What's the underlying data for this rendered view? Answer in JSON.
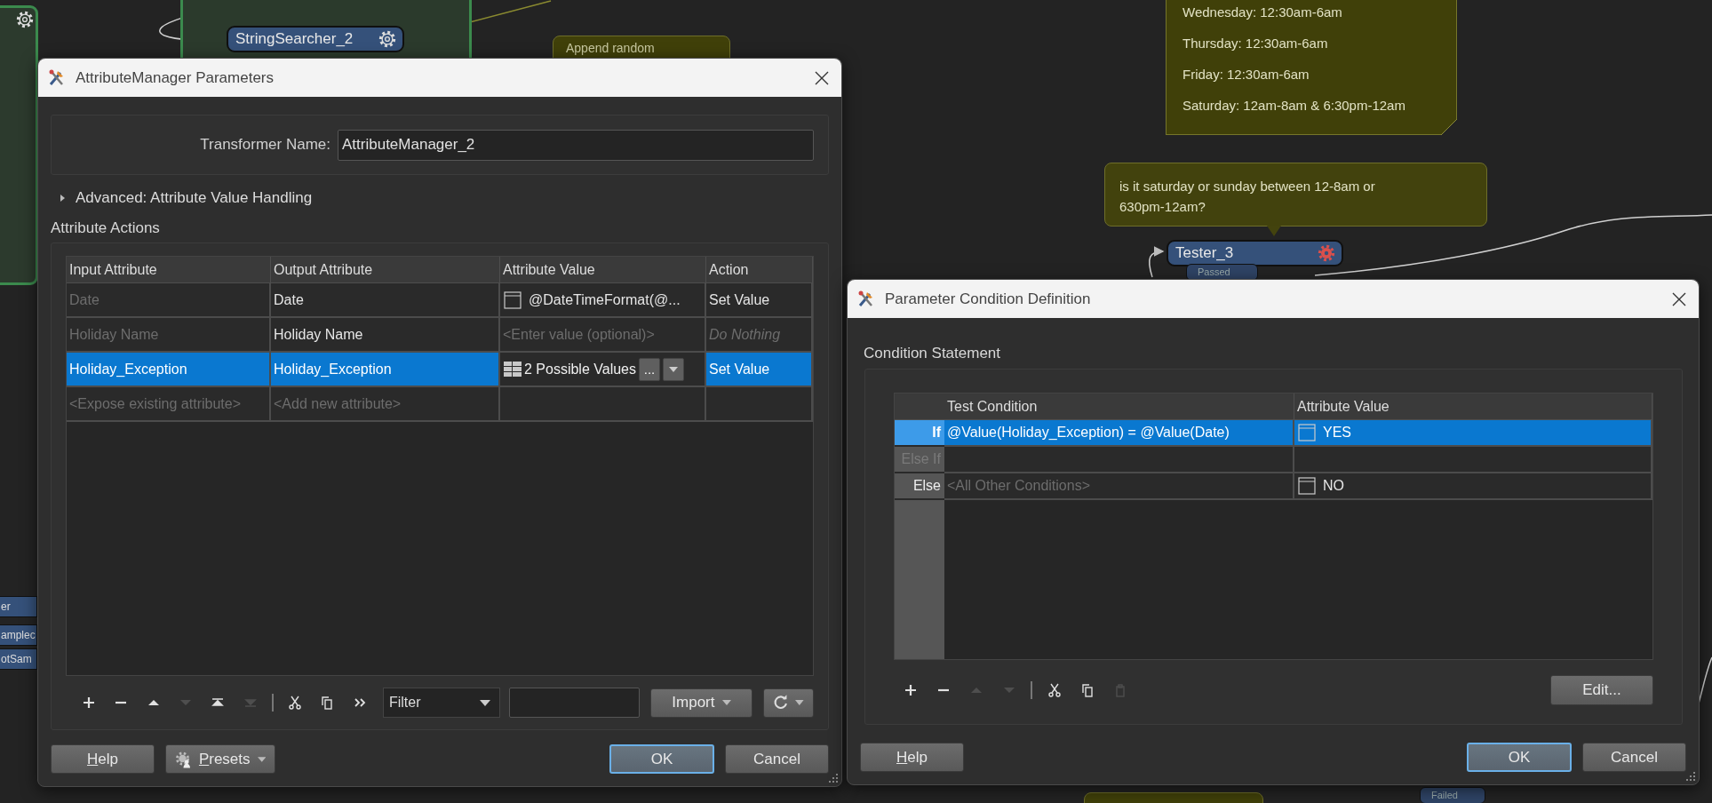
{
  "canvas": {
    "nodes": [
      {
        "name": "StringSearcher_2",
        "error": false
      },
      {
        "name": "Tester_3",
        "error": true
      }
    ],
    "ports": [
      {
        "label": "Passed"
      },
      {
        "label": "Failed"
      }
    ],
    "partial_nodes": [
      "er",
      "amplec",
      "otSam"
    ],
    "notes": [
      {
        "kind": "sticky",
        "lines": [
          "Wednesday: 12:30am-6am",
          "Thursday: 12:30am-6am",
          "Friday: 12:30am-6am",
          "Saturday: 12am-8am & 6:30pm-12am"
        ]
      },
      {
        "kind": "callout",
        "lines": [
          "is it saturday or sunday between 12-8am or 630pm-12am?"
        ]
      },
      {
        "kind": "plain",
        "lines": [
          "Append random"
        ]
      }
    ]
  },
  "attribute_manager_dialog": {
    "title": "AttributeManager Parameters",
    "transformer_name_label": "Transformer Name:",
    "transformer_name": "AttributeManager_2",
    "advanced_section": {
      "label": "Advanced: Attribute Value Handling",
      "expanded": false
    },
    "group_title": "Attribute Actions",
    "columns": [
      "Input Attribute",
      "Output Attribute",
      "Attribute Value",
      "Action"
    ],
    "rows": [
      {
        "selected": false,
        "input": {
          "text": "Date",
          "dim": true
        },
        "output": {
          "text": "Date",
          "dim": false
        },
        "value": {
          "kind": "text",
          "text": "@DateTimeFormat(@..."
        },
        "action": {
          "text": "Set Value",
          "dim": false
        }
      },
      {
        "selected": false,
        "input": {
          "text": "Holiday Name",
          "dim": true
        },
        "output": {
          "text": "Holiday Name",
          "dim": false
        },
        "value": {
          "kind": "placeholder",
          "text": "<Enter value (optional)>"
        },
        "action": {
          "text": "Do Nothing",
          "dim": true
        }
      },
      {
        "selected": true,
        "input": {
          "text": "Holiday_Exception",
          "dim": false
        },
        "output": {
          "text": "Holiday_Exception",
          "dim": false
        },
        "value": {
          "kind": "conditional",
          "text": "2 Possible Values",
          "more": "..."
        },
        "action": {
          "text": "Set Value",
          "dim": false
        }
      },
      {
        "selected": false,
        "input": {
          "text": "<Expose existing attribute>",
          "dim": true
        },
        "output": {
          "text": "<Add new attribute>",
          "dim": true
        },
        "value": {
          "kind": "empty"
        }
      }
    ],
    "edit_tools": [
      {
        "kind": "add",
        "disabled": false
      },
      {
        "kind": "remove",
        "disabled": false
      },
      {
        "kind": "move_up",
        "disabled": false
      },
      {
        "kind": "move_down",
        "disabled": true
      },
      {
        "kind": "move_top",
        "disabled": false
      },
      {
        "kind": "move_bottom",
        "disabled": true
      }
    ],
    "clipboard_tools": [
      {
        "kind": "cut",
        "disabled": false
      },
      {
        "kind": "copy",
        "disabled": false
      },
      {
        "kind": "more",
        "disabled": false
      }
    ],
    "filter_combo": "Filter",
    "import_button": "Import",
    "buttons": [
      {
        "label": "Help",
        "kind": "help",
        "mnemonic": true
      },
      {
        "label": "Presets",
        "kind": "menu",
        "mnemonic": true
      },
      {
        "label": "OK",
        "kind": "default",
        "mnemonic": false
      },
      {
        "label": "Cancel",
        "kind": "normal",
        "mnemonic": false
      }
    ]
  },
  "condition_dialog": {
    "title": "Parameter Condition Definition",
    "group_title": "Condition Statement",
    "columns": [
      "Test Condition",
      "Attribute Value"
    ],
    "rows": [
      {
        "label": "If",
        "selected": true,
        "label_dim": false,
        "condition": {
          "text": "@Value(Holiday_Exception) = @Value(Date)",
          "dim": false
        },
        "value": "YES"
      },
      {
        "label": "Else If",
        "selected": false,
        "label_dim": true
      },
      {
        "label": "Else",
        "selected": false,
        "label_dim": false,
        "condition": {
          "text": "<All Other Conditions>",
          "dim": true
        },
        "value": "NO"
      }
    ],
    "edit_tools": [
      {
        "kind": "add",
        "disabled": false
      },
      {
        "kind": "remove",
        "disabled": false
      },
      {
        "kind": "move_up",
        "disabled": true
      },
      {
        "kind": "move_down",
        "disabled": true
      }
    ],
    "clipboard_tools": [
      {
        "kind": "cut",
        "disabled": false
      },
      {
        "kind": "copy",
        "disabled": false
      },
      {
        "kind": "paste",
        "disabled": true
      }
    ],
    "edit_button": "Edit...",
    "buttons": [
      {
        "label": "Help",
        "kind": "help",
        "mnemonic": true
      },
      {
        "label": "OK",
        "kind": "default",
        "mnemonic": false
      },
      {
        "label": "Cancel",
        "kind": "normal",
        "mnemonic": false
      }
    ]
  }
}
